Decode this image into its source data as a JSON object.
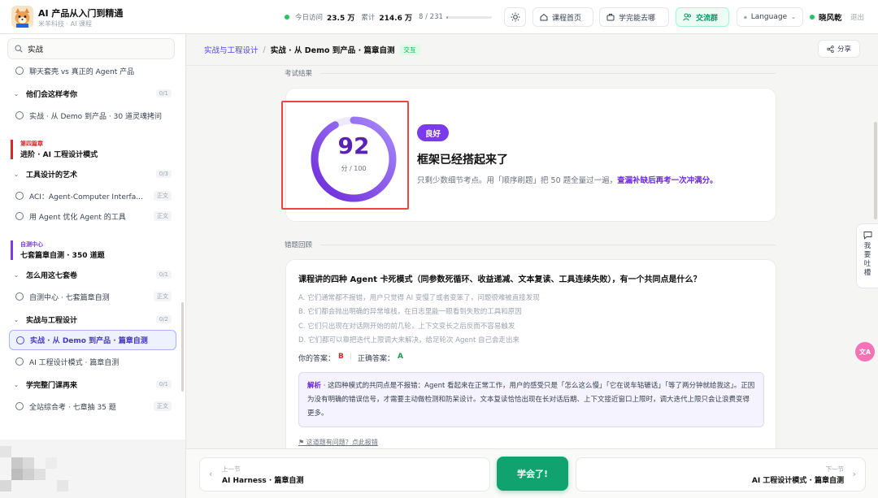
{
  "header": {
    "title": "AI 产品从入门到精通",
    "subtitle": "米羊科技 · AI 课程",
    "stats": {
      "today_label": "今日访问",
      "today_value": "23.5 万",
      "total_label": "累计",
      "total_value": "214.6 万",
      "progress_text": "8 / 231",
      "progress_fraction": 0.035
    },
    "buttons": {
      "home": "课程首页",
      "learn": "学完能去哪",
      "group": "交流群",
      "language": "Language"
    },
    "user": {
      "name": "晓风乾",
      "logout": "退出"
    }
  },
  "sidebar": {
    "search_value": "实战",
    "items": [
      {
        "label": "聊天套壳 vs 真正的 Agent 产品"
      },
      {
        "label": "他们会这样考你",
        "count": "0/1"
      },
      {
        "label": "实战 · 从 Demo 到产品 · 30 道灵魂拷问"
      },
      {
        "label": "工具设计的艺术",
        "count": "0/3"
      },
      {
        "label": "ACI：Agent-Computer Interfa...",
        "badge": "正文"
      },
      {
        "label": "用 Agent 优化 Agent 的工具",
        "badge": "正文"
      },
      {
        "label": "怎么用这七套卷",
        "count": "0/1"
      },
      {
        "label": "自测中心 · 七套篇章自测",
        "badge": "正文"
      },
      {
        "label": "实战与工程设计",
        "count": "0/2"
      },
      {
        "label": "实战 · 从 Demo 到产品 · 篇章自测"
      },
      {
        "label": "AI 工程设计模式 · 篇章自测"
      },
      {
        "label": "学完整门课再来",
        "count": "0/1"
      },
      {
        "label": "全站综合考 · 七章抽 35 题",
        "badge": "正文"
      }
    ],
    "sections": [
      {
        "eyebrow": "第四篇章",
        "title": "进阶 · AI 工程设计模式",
        "color": "#dc2626"
      },
      {
        "eyebrow": "自测中心",
        "title": "七套篇章自测 · 350 道题",
        "color": "#7c3aed"
      }
    ]
  },
  "breadcrumb": {
    "parent": "实战与工程设计",
    "sep": "/",
    "current": "实战 · 从 Demo 到产品 · 篇章自测",
    "tag": "交互"
  },
  "share_label": "分享",
  "result": {
    "section_label": "考试结果",
    "score": "92",
    "score_fraction": 0.92,
    "score_sub": "分 / 100",
    "grade": "良好",
    "headline": "框架已经搭起来了",
    "desc": "只剩少数细节考点。用「顺序刷题」把 50 题全量过一遍，",
    "desc_link": "查漏补缺后再考一次冲满分。"
  },
  "review": {
    "section_label": "错题回顾",
    "question": "课程讲的四种 Agent 卡死模式（同参数死循环、收益递减、文本复读、工具连续失败），有一个共同点是什么？",
    "options": [
      "A. 它们通常都不报错，用户只觉得 AI 变慢了或者变笨了，问题很难被直接发现",
      "B. 它们都会抛出明确的异常堆栈，在日志里能一眼看到失败的工具和原因",
      "C. 它们只出现在对话刚开始的前几轮，上下文变长之后反而不容易触发",
      "D. 它们都可以靠把迭代上限调大来解决，给足轮次 Agent 自己会走出来"
    ],
    "your_answer_label": "你的答案：",
    "your_answer": "B",
    "correct_label": "正确答案：",
    "correct_answer": "A",
    "explain_label": "解析",
    "explain_text": " · 这四种模式的共同点是不报错：Agent 看起来在正常工作，用户的感受只是「怎么这么慢」「它在说车轱辘话」「等了两分钟就给我这」。正因为没有明确的错误信号，才需要主动做检测和防呆设计。文本复读恰恰出现在长对话后期、上下文接近窗口上限时，调大迭代上限只会让浪费变得更多。",
    "report": "⚑ 这道题有问题？点此报错"
  },
  "side_tools": {
    "feedback": "我要吐槽",
    "translate": "文A"
  },
  "bottom_nav": {
    "prev_label": "上一节",
    "prev_title": "AI Harness · 篇章自测",
    "learned": "学会了!",
    "next_label": "下一节",
    "next_title": "AI 工程设计模式 · 篇章自测"
  },
  "colors": {
    "accent": "#7c3aed",
    "brand_green": "#10a36f",
    "highlight": "#ef4444"
  }
}
